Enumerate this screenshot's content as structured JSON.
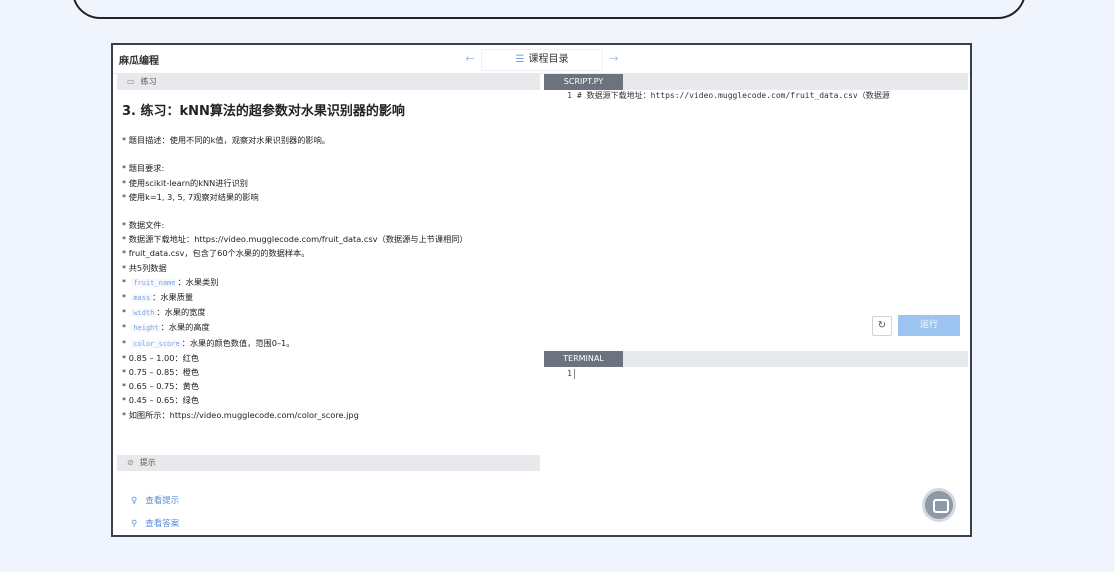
{
  "app": {
    "brand": "麻瓜编程"
  },
  "nav": {
    "prev": "←",
    "center_label": "课程目录",
    "next": "→"
  },
  "left": {
    "section_label": "练习",
    "title": "3. 练习：kNN算法的超参数对水果识别器的影响",
    "lines": {
      "l1": "* 题目描述：使用不同的k值，观察对水果识别器的影响。",
      "l2": "* 题目要求:",
      "l3": "* 使用scikit-learn的kNN进行识别",
      "l4": "* 使用k=1, 3, 5, 7观察对结果的影响",
      "l5": "* 数据文件:",
      "l6": "* 数据源下载地址：https://video.mugglecode.com/fruit_data.csv（数据源与上节课相同）",
      "l7": "* fruit_data.csv，包含了60个水果的的数据样本。",
      "l8": "* 共5列数据",
      "c1_code": "fruit_name",
      "c1_text": "：水果类别",
      "c2_code": "mass",
      "c2_text": "：水果质量",
      "c3_code": "width",
      "c3_text": "：水果的宽度",
      "c4_code": "height",
      "c4_text": "：水果的高度",
      "c5_code": "color_score",
      "c5_text": "：水果的颜色数值，范围0–1。",
      "r1": "* 0.85 – 1.00：红色",
      "r2": "* 0.75 – 0.85：橙色",
      "r3": "* 0.65 – 0.75：黄色",
      "r4": "* 0.45 – 0.65：绿色",
      "img": "* 如图所示：https://video.mugglecode.com/color_score.jpg"
    },
    "hints_label": "提示",
    "view_hint": "查看提示",
    "view_answer": "查看答案"
  },
  "editor": {
    "tab": "SCRIPT.PY",
    "line_no": "1",
    "line1": "# 数据源下载地址：https://video.mugglecode.com/fruit_data.csv（数据源"
  },
  "buttons": {
    "reset_icon": "↻",
    "run": "运行"
  },
  "terminal": {
    "tab": "TERMINAL",
    "line_no": "1"
  },
  "colors": {
    "accent": "#9dc4f0",
    "tab_active": "#6c737e",
    "link": "#5b8fd8"
  }
}
